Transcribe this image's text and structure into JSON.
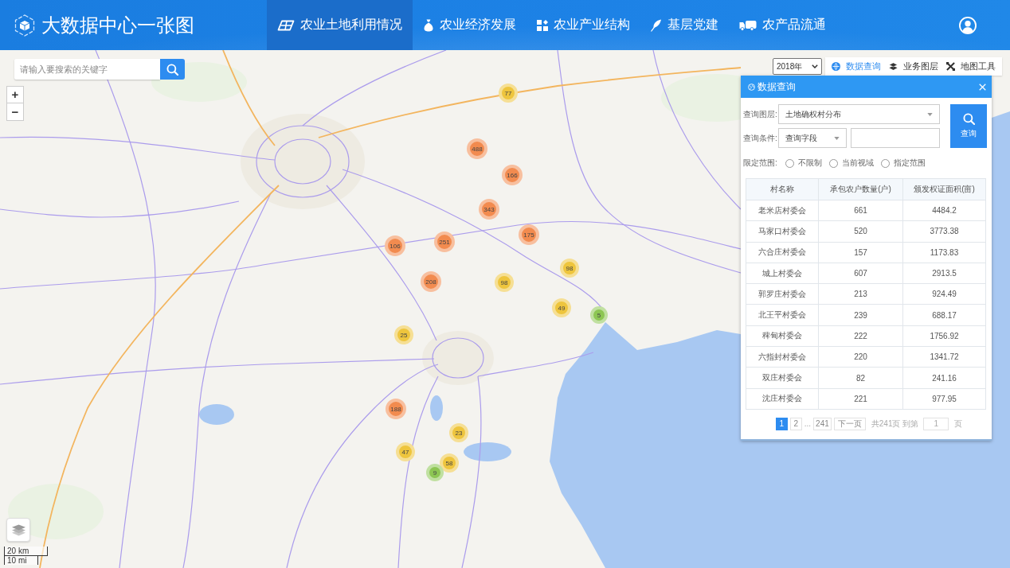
{
  "header": {
    "title": "大数据中心一张图",
    "nav": [
      {
        "label": "农业土地利用情况",
        "selected": true
      },
      {
        "label": "农业经济发展",
        "selected": false
      },
      {
        "label": "农业产业结构",
        "selected": false
      },
      {
        "label": "基层党建",
        "selected": false
      },
      {
        "label": "农产品流通",
        "selected": false
      }
    ]
  },
  "map": {
    "search": {
      "placeholder": "请输入要搜索的关键字"
    },
    "zoom": [
      "+",
      "−"
    ],
    "clusters": [
      {
        "count": "77",
        "color": "#eec53d"
      },
      {
        "count": "488",
        "color": "#f28b4f"
      },
      {
        "count": "166",
        "color": "#f28b4f"
      },
      {
        "count": "343",
        "color": "#f28b4f"
      },
      {
        "count": "175",
        "color": "#f28b4f"
      },
      {
        "count": "251",
        "color": "#f28b4f"
      },
      {
        "count": "106",
        "color": "#f28b4f"
      },
      {
        "count": "98",
        "color": "#eec53d"
      },
      {
        "count": "208",
        "color": "#f28b4f"
      },
      {
        "count": "98",
        "color": "#eec53d"
      },
      {
        "count": "49",
        "color": "#eec53d"
      },
      {
        "count": "5",
        "color": "#8dc653"
      },
      {
        "count": "25",
        "color": "#eec53d"
      },
      {
        "count": "188",
        "color": "#f28b4f"
      },
      {
        "count": "23",
        "color": "#eec53d"
      },
      {
        "count": "47",
        "color": "#eec53d"
      },
      {
        "count": "58",
        "color": "#eec53d"
      },
      {
        "count": "9",
        "color": "#8dc653"
      }
    ],
    "scale": [
      "20 km",
      "10 mi"
    ]
  },
  "toolbar": {
    "year": "2018年",
    "items": [
      {
        "label": "数据查询",
        "selected": true
      },
      {
        "label": "业务图层",
        "selected": false
      },
      {
        "label": "地图工具",
        "selected": false
      }
    ]
  },
  "panel": {
    "title": "数据查询",
    "layer_label": "查询图层:",
    "layer_value": "土地确权村分布",
    "condition_label": "查询条件:",
    "condition_value": "查询字段",
    "query_button": "查询",
    "scope_label": "限定范围:",
    "scope_options": [
      {
        "label": "不限制",
        "selected": false
      },
      {
        "label": "当前视域",
        "selected": false
      },
      {
        "label": "指定范围",
        "selected": false
      }
    ],
    "table": {
      "columns": [
        "村名称",
        "承包农户数量(户)",
        "颁发权证面积(亩)"
      ],
      "rows": [
        [
          "老米店村委会",
          "661",
          "4484.2"
        ],
        [
          "马家口村委会",
          "520",
          "3773.38"
        ],
        [
          "六合庄村委会",
          "157",
          "1173.83"
        ],
        [
          "城上村委会",
          "607",
          "2913.5"
        ],
        [
          "郭罗庄村委会",
          "213",
          "924.49"
        ],
        [
          "北王平村委会",
          "239",
          "688.17"
        ],
        [
          "稗甸村委会",
          "222",
          "1756.92"
        ],
        [
          "六指封村委会",
          "220",
          "1341.72"
        ],
        [
          "双庄村委会",
          "82",
          "241.16"
        ],
        [
          "沈庄村委会",
          "221",
          "977.95"
        ]
      ]
    },
    "pagination": {
      "items": [
        {
          "kind": "page",
          "label": "1",
          "selected": true
        },
        {
          "kind": "page",
          "label": "2",
          "selected": false
        },
        {
          "kind": "gap",
          "label": "..."
        },
        {
          "kind": "page",
          "label": "241",
          "selected": false
        },
        {
          "kind": "next",
          "label": "下一页"
        }
      ],
      "total": "共241页 到第",
      "goto": "1",
      "unit": "页"
    }
  }
}
